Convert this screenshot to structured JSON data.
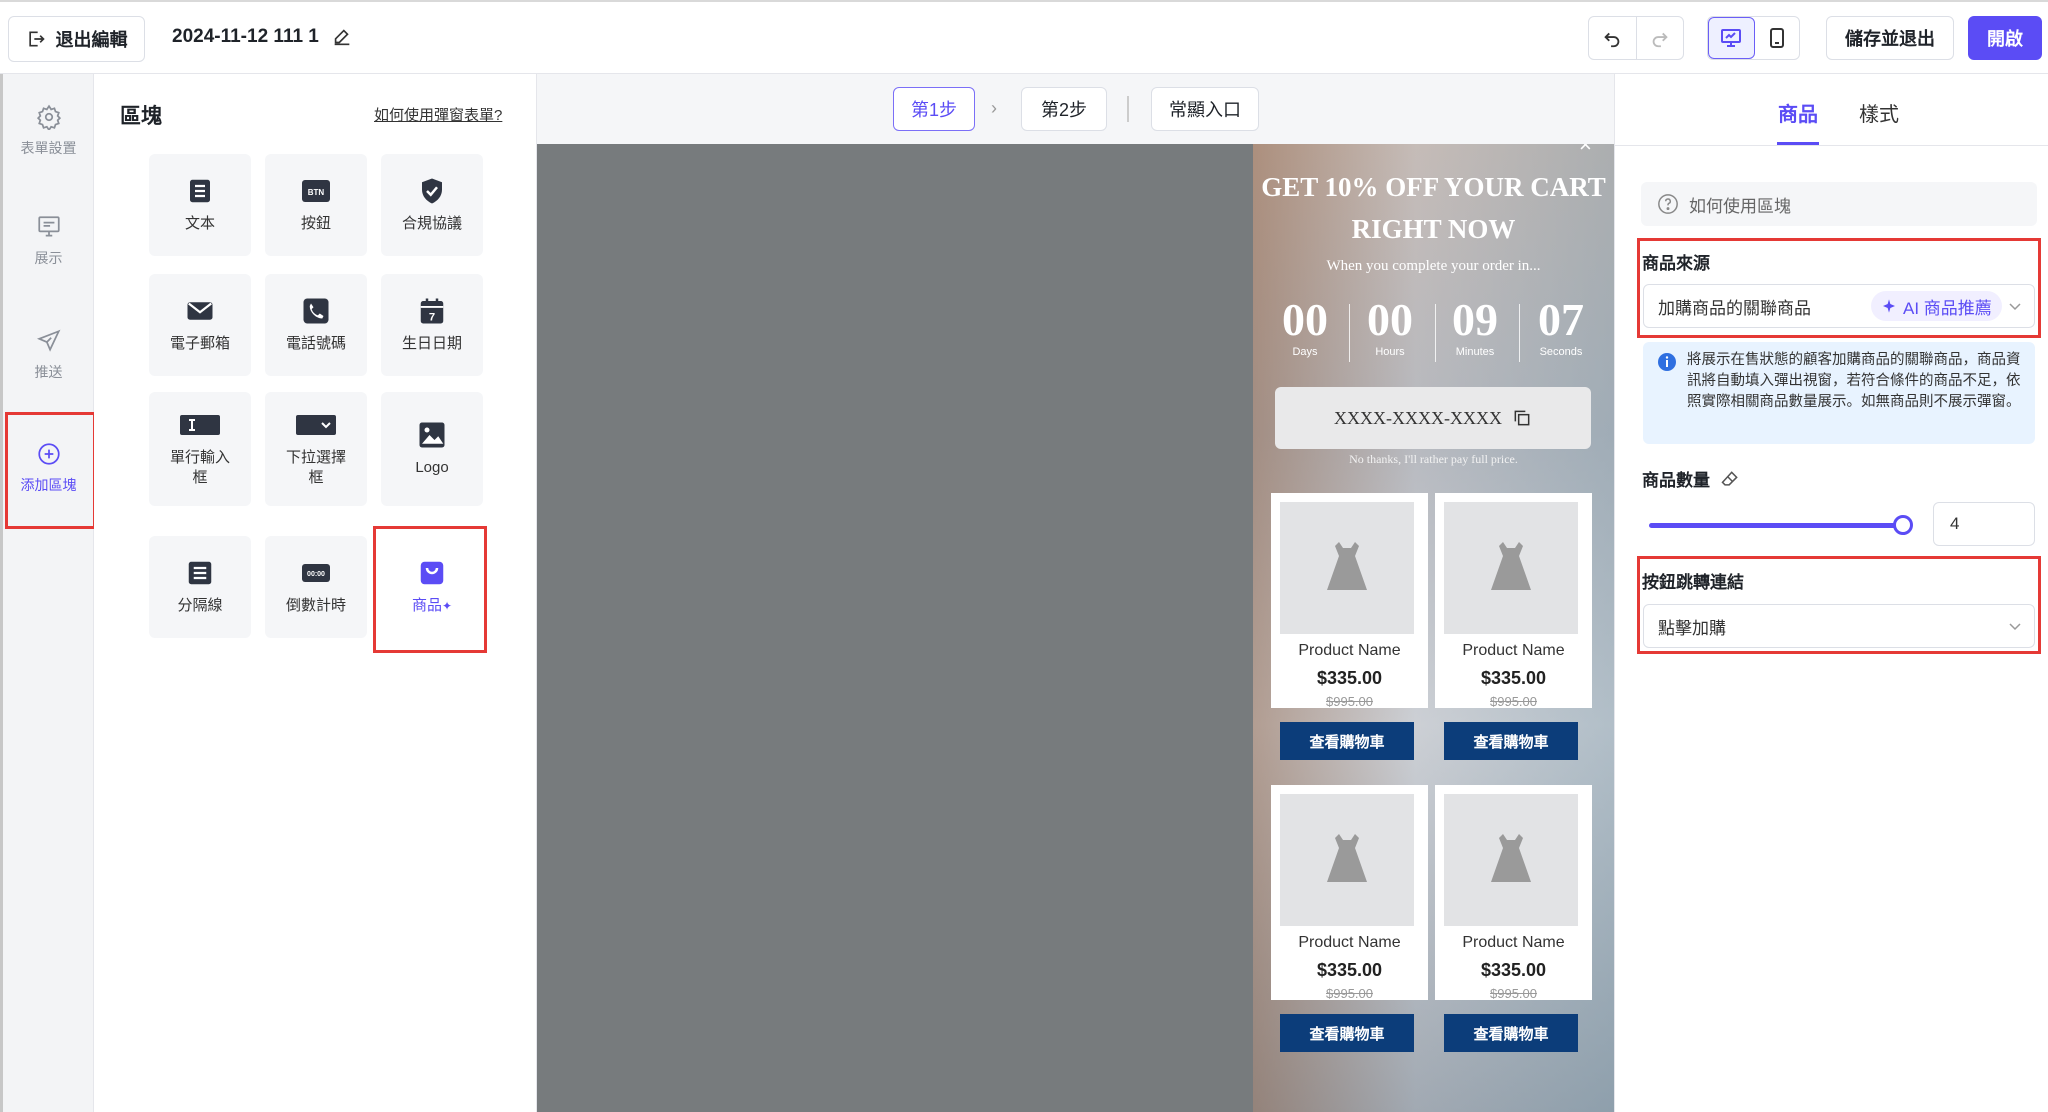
{
  "topbar": {
    "exit_label": "退出編輯",
    "doc_title": "2024-11-12 111 1",
    "save_exit_label": "儲存並退出",
    "open_label": "開啟"
  },
  "rail": {
    "items": [
      {
        "label": "表單設置",
        "icon": "gear-icon"
      },
      {
        "label": "展示",
        "icon": "display-icon"
      },
      {
        "label": "推送",
        "icon": "send-icon"
      },
      {
        "label": "添加區塊",
        "icon": "add-circle-icon",
        "active": true
      }
    ]
  },
  "blocks": {
    "title": "區塊",
    "help_link": "如何使用彈窗表單?",
    "tiles": [
      {
        "label": "文本",
        "icon": "text-doc-icon"
      },
      {
        "label": "按鈕",
        "icon": "button-icon",
        "icon_text": "BTN"
      },
      {
        "label": "合規協議",
        "icon": "shield-check-icon"
      },
      {
        "label": "電子郵箱",
        "icon": "email-icon"
      },
      {
        "label": "電話號碼",
        "icon": "phone-icon"
      },
      {
        "label": "生日日期",
        "icon": "calendar-icon",
        "icon_text": "7"
      },
      {
        "label": "單行輸入框",
        "icon": "text-input-icon"
      },
      {
        "label": "下拉選擇框",
        "icon": "dropdown-icon"
      },
      {
        "label": "Logo",
        "icon": "image-icon"
      },
      {
        "label": "分隔線",
        "icon": "divider-icon"
      },
      {
        "label": "倒數計時",
        "icon": "countdown-icon",
        "icon_text": "00:00"
      },
      {
        "label": "商品",
        "icon": "shopping-bag-icon",
        "active": true
      }
    ]
  },
  "canvas": {
    "steps": [
      "第1步",
      "第2步"
    ],
    "entry_label": "常顯入口",
    "popup": {
      "title_line1": "GET 10% OFF YOUR CART",
      "title_line2": "RIGHT NOW",
      "subtitle": "When you complete your order in...",
      "countdown": [
        {
          "value": "00",
          "unit": "Days"
        },
        {
          "value": "00",
          "unit": "Hours"
        },
        {
          "value": "09",
          "unit": "Minutes"
        },
        {
          "value": "07",
          "unit": "Seconds"
        }
      ],
      "coupon_code": "XXXX-XXXX-XXXX",
      "no_thanks": "No thanks, I'll rather pay full price.",
      "close": "×",
      "products": [
        {
          "name": "Product Name",
          "price": "$335.00",
          "original": "$995.00",
          "button": "查看購物車"
        },
        {
          "name": "Product Name",
          "price": "$335.00",
          "original": "$995.00",
          "button": "查看購物車"
        },
        {
          "name": "Product Name",
          "price": "$335.00",
          "original": "$995.00",
          "button": "查看購物車"
        },
        {
          "name": "Product Name",
          "price": "$335.00",
          "original": "$995.00",
          "button": "查看購物車"
        }
      ]
    }
  },
  "rpanel": {
    "tabs": [
      "商品",
      "樣式"
    ],
    "help": "如何使用區塊",
    "source_label": "商品來源",
    "source_value": "加購商品的關聯商品",
    "ai_chip": "AI 商品推薦",
    "info": "將展示在售狀態的顧客加購商品的關聯商品，商品資訊將自動填入彈出視窗，若符合條件的商品不足，依照實際相關商品數量展示。如無商品則不展示彈窗。",
    "quantity_label": "商品數量",
    "quantity_value": "4",
    "quantity_fraction": 1.0,
    "link_label": "按鈕跳轉連結",
    "link_value": "點擊加購"
  },
  "colors": {
    "accent": "#5b4cf5",
    "highlight_red": "#e53935",
    "cart_button": "#0c3d7a",
    "canvas_bg": "#777b7d"
  }
}
